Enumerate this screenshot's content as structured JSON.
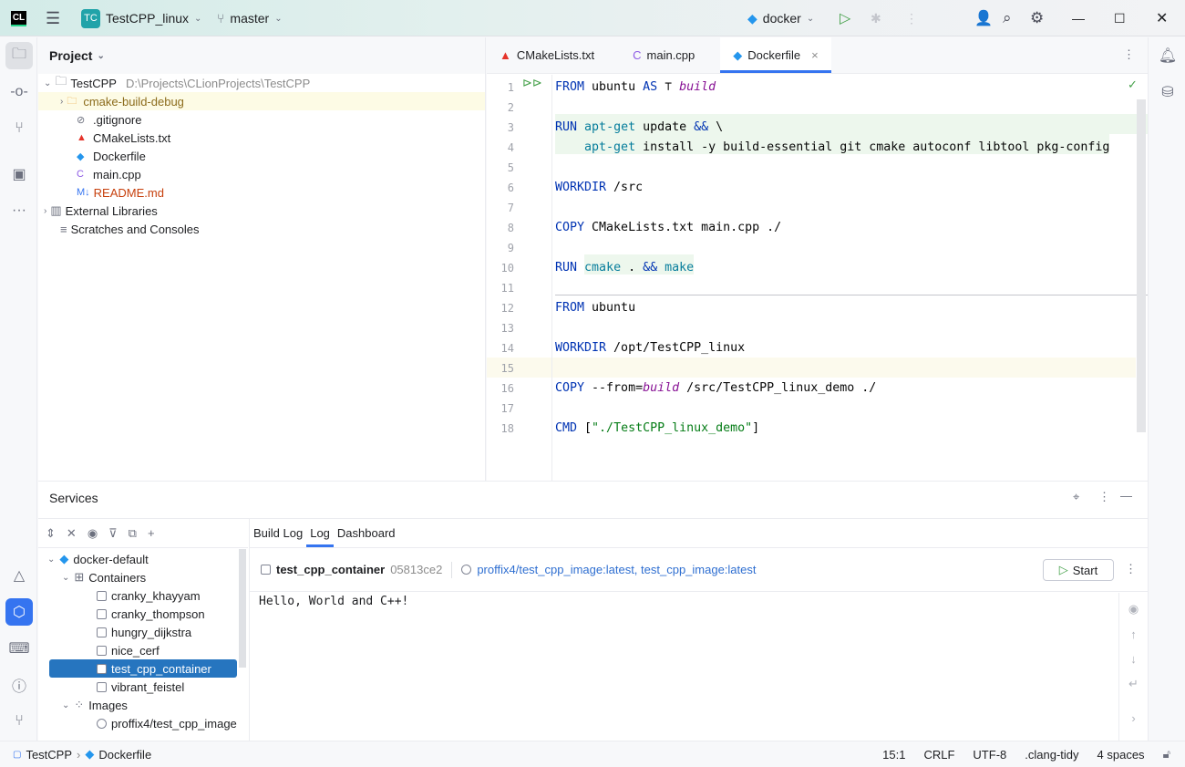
{
  "titlebar": {
    "app_logo": "CL",
    "project_badge": "TC",
    "project": "TestCPP_linux",
    "branch": "master",
    "run_config": "docker"
  },
  "project_panel": {
    "title": "Project",
    "root": "TestCPP",
    "root_path": "D:\\Projects\\CLionProjects\\TestCPP",
    "items": [
      {
        "label": "cmake-build-debug",
        "icon": "folder-icon"
      },
      {
        "label": ".gitignore",
        "icon": "ignore-icon"
      },
      {
        "label": "CMakeLists.txt",
        "icon": "cmake-icon"
      },
      {
        "label": "Dockerfile",
        "icon": "docker-icon"
      },
      {
        "label": "main.cpp",
        "icon": "cpp-icon"
      },
      {
        "label": "README.md",
        "icon": "markdown-icon"
      }
    ],
    "external": "External Libraries",
    "scratches": "Scratches and Consoles"
  },
  "editor": {
    "tabs": [
      "CMakeLists.txt",
      "main.cpp",
      "Dockerfile"
    ],
    "active_tab": 2,
    "lines": [
      [
        [
          "kw",
          "FROM"
        ],
        [
          "pl",
          " ubuntu "
        ],
        [
          "kw",
          "AS"
        ],
        [
          "pl",
          " ⊤ "
        ],
        [
          "it",
          "build"
        ]
      ],
      [],
      [
        [
          "kw",
          "RUN"
        ],
        [
          "pl",
          " "
        ],
        [
          "cmd",
          "apt-get"
        ],
        [
          "pl",
          " update "
        ],
        [
          "kw",
          "&&"
        ],
        [
          "pl",
          " \\"
        ]
      ],
      [
        [
          "pl",
          "    "
        ],
        [
          "cmd",
          "apt-get"
        ],
        [
          "pl",
          " install -y build-essential git cmake autoconf libtool pkg-config"
        ]
      ],
      [],
      [
        [
          "kw",
          "WORKDIR"
        ],
        [
          "pl",
          " /src"
        ]
      ],
      [],
      [
        [
          "kw",
          "COPY"
        ],
        [
          "pl",
          " CMakeLists.txt main.cpp ./"
        ]
      ],
      [],
      [
        [
          "kw",
          "RUN"
        ],
        [
          "pl",
          " "
        ],
        [
          "cmd",
          "cmake"
        ],
        [
          "pl",
          " . "
        ],
        [
          "kw",
          "&&"
        ],
        [
          "pl",
          " "
        ],
        [
          "cmd",
          "make"
        ]
      ],
      [],
      [
        [
          "kw",
          "FROM"
        ],
        [
          "pl",
          " ubuntu"
        ]
      ],
      [],
      [
        [
          "kw",
          "WORKDIR"
        ],
        [
          "pl",
          " /opt/TestCPP_linux"
        ]
      ],
      [],
      [
        [
          "kw",
          "COPY"
        ],
        [
          "pl",
          " --from="
        ],
        [
          "it",
          "build"
        ],
        [
          "pl",
          " /src/TestCPP_linux_demo ./"
        ]
      ],
      [],
      [
        [
          "kw",
          "CMD"
        ],
        [
          "pl",
          " ["
        ],
        [
          "str",
          "\"./TestCPP_linux_demo\""
        ],
        [
          "pl",
          "]"
        ]
      ]
    ]
  },
  "services": {
    "title": "Services",
    "tabs": [
      "Build Log",
      "Log",
      "Dashboard"
    ],
    "active_tab": 1,
    "tree": {
      "root": "docker-default",
      "containers_label": "Containers",
      "containers": [
        "cranky_khayyam",
        "cranky_thompson",
        "hungry_dijkstra",
        "nice_cerf",
        "test_cpp_container",
        "vibrant_feistel"
      ],
      "selected": "test_cpp_container",
      "images_label": "Images",
      "images": [
        "proffix4/test_cpp_image"
      ]
    },
    "container": {
      "name": "test_cpp_container",
      "id": "05813ce2",
      "image": "proffix4/test_cpp_image:latest, test_cpp_image:latest",
      "start_label": "Start"
    },
    "log": "Hello, World and C++!"
  },
  "statusbar": {
    "crumbs": [
      "TestCPP",
      "Dockerfile"
    ],
    "position": "15:1",
    "line_sep": "CRLF",
    "encoding": "UTF-8",
    "inspection": ".clang-tidy",
    "indent": "4 spaces"
  },
  "colors": {
    "accent": "#3574f0",
    "selection": "#2675bf",
    "keyword": "#0033b3",
    "command": "#067d9c",
    "string": "#067d17"
  }
}
